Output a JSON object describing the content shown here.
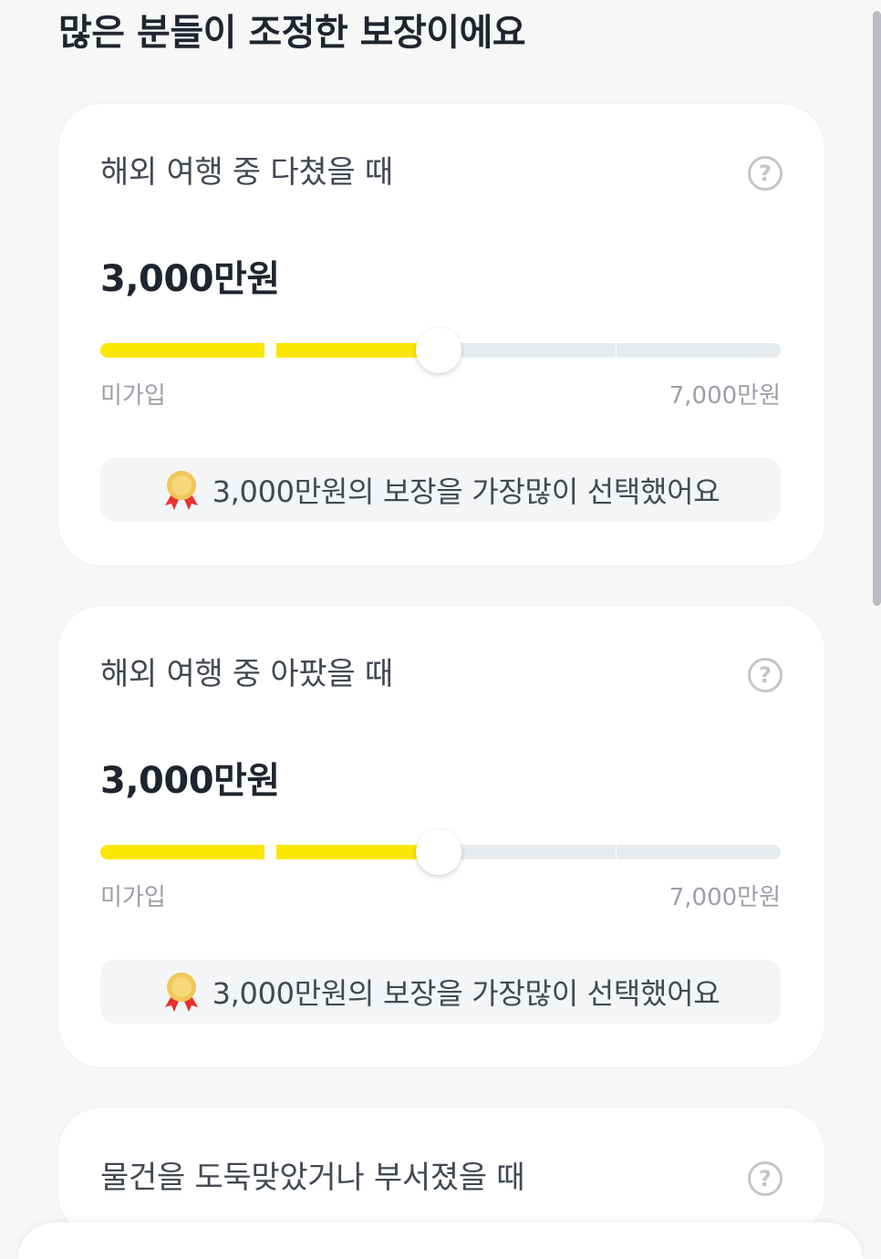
{
  "page_title": "많은 분들이 조정한 보장이에요",
  "help_glyph": "?",
  "cards": [
    {
      "title": "해외 여행 중 다쳤을 때",
      "amount": "3,000만원",
      "slider_min_label": "미가입",
      "slider_max_label": "7,000만원",
      "slider_value_fraction": 0.5,
      "badge_icon": "medal-icon",
      "badge_text": "3,000만원의 보장을 가장많이 선택했어요"
    },
    {
      "title": "해외 여행 중 아팠을 때",
      "amount": "3,000만원",
      "slider_min_label": "미가입",
      "slider_max_label": "7,000만원",
      "slider_value_fraction": 0.5,
      "badge_icon": "medal-icon",
      "badge_text": "3,000만원의 보장을 가장많이 선택했어요"
    },
    {
      "title": "물건을 도둑맞았거나 부서졌을 때"
    }
  ],
  "colors": {
    "accent": "#fce604",
    "track": "#e8ebee",
    "background": "#f7f7f8"
  }
}
